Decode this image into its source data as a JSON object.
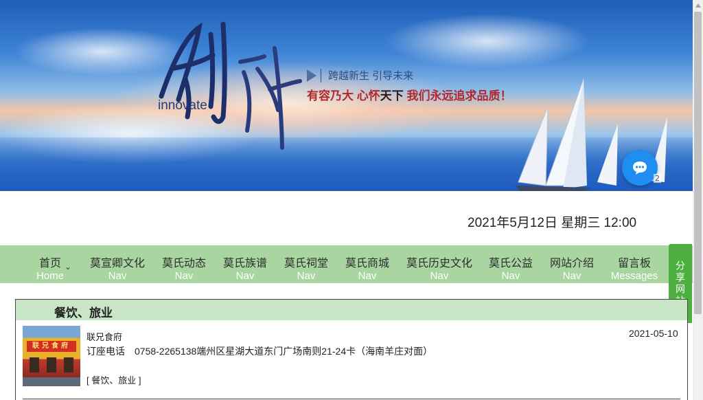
{
  "banner": {
    "logo_word": "innovate",
    "slogan_line1": "跨越新生  引导未来",
    "slogan_line2_red1": "有容乃大 心怀",
    "slogan_line2_dark": "天下",
    "slogan_line2_red2": " 我们永远追求品质！",
    "chat_badge": "2"
  },
  "datetime": "2021年5月12日 星期三 12:00",
  "nav": {
    "items": [
      {
        "cn": "首页",
        "en": "Home"
      },
      {
        "cn": "莫宣卿文化",
        "en": "Nav"
      },
      {
        "cn": "莫氏动态",
        "en": "Nav"
      },
      {
        "cn": "莫氏族谱",
        "en": "Nav"
      },
      {
        "cn": "莫氏祠堂",
        "en": "Nav"
      },
      {
        "cn": "莫氏商城",
        "en": "Nav"
      },
      {
        "cn": "莫氏历史文化",
        "en": "Nav"
      },
      {
        "cn": "莫氏公益",
        "en": "Nav"
      },
      {
        "cn": "网站介绍",
        "en": "Nav"
      },
      {
        "cn": "留言板",
        "en": "Messages"
      }
    ]
  },
  "share_tab": "分享网站",
  "category": {
    "title": "餐饮、旅业",
    "entries": [
      {
        "name": "联兄食府",
        "description": "订座电话　0758-2265138端州区星湖大道东门广场南则21-24卡（海南羊庄对面）",
        "tag": "[ 餐饮、旅业 ]",
        "date": "2021-05-10",
        "thumb_sign": "联兄食府"
      }
    ]
  },
  "colors": {
    "nav_bg": "#a8d5a0",
    "category_header_bg": "#c8e6c6",
    "share_tab_bg": "#4caf3f",
    "chat_button": "#1e8ff0",
    "slogan_red": "#b3262b"
  }
}
